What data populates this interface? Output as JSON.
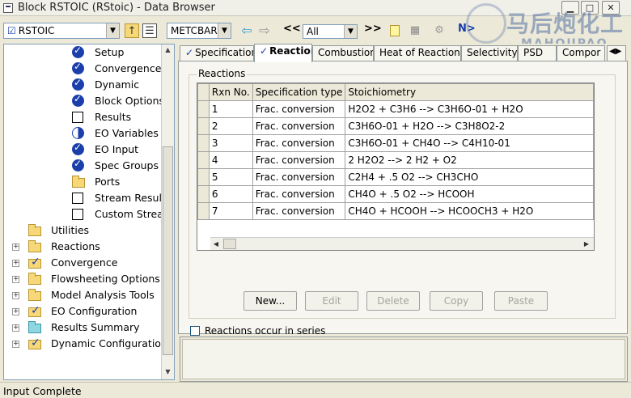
{
  "window": {
    "title": "Block RSTOIC (RStoic) - Data Browser",
    "btn_min": "▁",
    "btn_max": "□",
    "btn_close": "✕"
  },
  "toolbar": {
    "block_select": "RSTOIC",
    "units_select": "METCBAR",
    "back_arrow": "⇦",
    "forward_arrow": "⇨",
    "prev_label": "<<",
    "next_label": ">>",
    "filter_select": "All",
    "next_label_n": "N>"
  },
  "watermark": {
    "line1": "马后炮化工",
    "line2": "MAHOUPAO"
  },
  "tree": {
    "items": [
      {
        "label": "Setup",
        "icon": "check-circle-icon"
      },
      {
        "label": "Convergence",
        "icon": "check-circle-icon"
      },
      {
        "label": "Dynamic",
        "icon": "check-circle-icon"
      },
      {
        "label": "Block Options",
        "icon": "check-circle-icon"
      },
      {
        "label": "Results",
        "icon": "empty-box-icon"
      },
      {
        "label": "EO Variables",
        "icon": "half-circle-icon"
      },
      {
        "label": "EO Input",
        "icon": "check-circle-icon"
      },
      {
        "label": "Spec Groups",
        "icon": "check-circle-icon"
      },
      {
        "label": "Ports",
        "icon": "folder-icon"
      },
      {
        "label": "Stream Results",
        "icon": "empty-box-icon"
      },
      {
        "label": "Custom Stream",
        "icon": "empty-box-icon"
      },
      {
        "label": "Utilities",
        "icon": "folder-icon"
      },
      {
        "label": "Reactions",
        "icon": "folder-icon"
      },
      {
        "label": "Convergence",
        "icon": "folder-check-icon"
      },
      {
        "label": "Flowsheeting Options",
        "icon": "folder-icon"
      },
      {
        "label": "Model Analysis Tools",
        "icon": "folder-icon"
      },
      {
        "label": "EO Configuration",
        "icon": "folder-check-icon"
      },
      {
        "label": "Results Summary",
        "icon": "folder-teal-icon"
      },
      {
        "label": "Dynamic Configuration",
        "icon": "folder-check-icon"
      }
    ]
  },
  "tabs": [
    {
      "label": "Specifications",
      "checked": true
    },
    {
      "label": "Reactions",
      "checked": true
    },
    {
      "label": "Combustion",
      "checked": false
    },
    {
      "label": "Heat of Reaction",
      "checked": false
    },
    {
      "label": "Selectivity",
      "checked": false
    },
    {
      "label": "PSD",
      "checked": false
    },
    {
      "label": "Compor",
      "checked": false
    }
  ],
  "reactions": {
    "group_title": "Reactions",
    "columns": [
      "Rxn No.",
      "Specification type",
      "Stoichiometry"
    ],
    "rows": [
      {
        "no": "1",
        "type": "Frac. conversion",
        "stoich": "H2O2 + C3H6 --> C3H6O-01 + H2O"
      },
      {
        "no": "2",
        "type": "Frac. conversion",
        "stoich": "C3H6O-01 + H2O --> C3H8O2-2"
      },
      {
        "no": "3",
        "type": "Frac. conversion",
        "stoich": "C3H6O-01 + CH4O --> C4H10-01"
      },
      {
        "no": "4",
        "type": "Frac. conversion",
        "stoich": "2 H2O2 --> 2 H2 + O2"
      },
      {
        "no": "5",
        "type": "Frac. conversion",
        "stoich": "C2H4 + .5 O2 --> CH3CHO"
      },
      {
        "no": "6",
        "type": "Frac. conversion",
        "stoich": "CH4O + .5 O2 --> HCOOH"
      },
      {
        "no": "7",
        "type": "Frac. conversion",
        "stoich": "CH4O + HCOOH --> HCOOCH3 + H2O"
      }
    ],
    "buttons": {
      "new": "New...",
      "edit": "Edit",
      "delete": "Delete",
      "copy": "Copy",
      "paste": "Paste"
    },
    "series_checkbox": "Reactions occur in series"
  },
  "status": {
    "text": "Input Complete"
  }
}
